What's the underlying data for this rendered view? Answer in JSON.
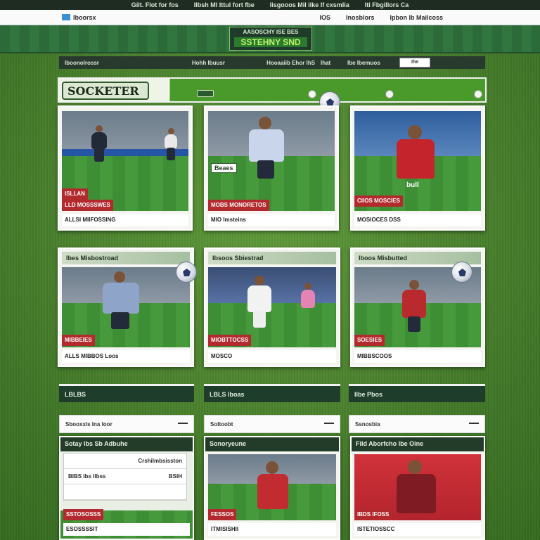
{
  "top_strip": [
    "Gilt. Flot for fos",
    "Ilbsh Ml Ittul fort fbe",
    "Iisgooos Mil ilke If cxsmlia",
    "Iti Fbgillors Ca"
  ],
  "nav": {
    "brand_label": "Iboorsx",
    "right_items": [
      "IOS",
      "Inosblors",
      "Ipbon Ib Mailcoss"
    ]
  },
  "hero": {
    "line1": "AASOSCHY ISE BES",
    "line2": "SSTEHNY SND"
  },
  "toolbar": {
    "item1": "Iboonolrossr",
    "item2": "Hohh Ibuusr",
    "item3": "Hooaaiib Ehor IhS",
    "item4": "Ihat",
    "item5": "Ibe Ibemuos",
    "search_placeholder": "Ihe"
  },
  "main": {
    "brand": "SOCKETER"
  },
  "row1": [
    {
      "caption_red": "LLD MOSSSWES",
      "caption_bottom": "ALLSI MIIFOSSING",
      "extra": "ISLLAN"
    },
    {
      "name_tag": "Beaes",
      "caption_red": "MOBS MONORETOS",
      "caption_bottom": "MIO Imsteins"
    },
    {
      "jersey": "bull",
      "caption_red": "CIIOS MOSCIES",
      "caption_bottom": "MOSIOCES DSS"
    }
  ],
  "row2": [
    {
      "label": "Ibes Misbostroad",
      "caption_red": "MIBBEIES",
      "caption_bottom": "ALLS MIBBOS Loos"
    },
    {
      "label": "Ibsoos Sbiestrad",
      "caption_red": "MIOBTTOCSS",
      "caption_bottom": "MOSCO"
    },
    {
      "label": "Iboos Misbutted",
      "caption_red": "SOESIES",
      "caption_bottom": "MIBBSCOOS"
    }
  ],
  "sections": [
    {
      "title": "LBLBS",
      "row": "Sbooxxls Ina Ioor"
    },
    {
      "title": "LBLS lboas",
      "row": "Soltoobt"
    },
    {
      "title": "Ilbe Pbos",
      "row": "Ssnosbia"
    }
  ],
  "bottom": [
    {
      "subhead": "Sotay Ibs Sb Adbuhe",
      "rows": [
        {
          "k": "",
          "v": "Crshilmbsisston"
        },
        {
          "k": "BIBS Ibs Ilbss",
          "v": "BSIH"
        },
        {
          "k": "",
          "v": ""
        }
      ],
      "caption_red": "SSTOSOSSS",
      "caption_bottom": "ESOSSSSIT"
    },
    {
      "subhead": "Sonoryeune",
      "caption_red": "FESSOS",
      "caption_bottom": "ITMISISHII"
    },
    {
      "subhead": "Fild Aborfcho Ibe Oine",
      "caption_red": "IBDS IFOSS",
      "caption_bottom": "ISTETIOSSCC"
    }
  ],
  "colors": {
    "grass": "#4f8a33",
    "dark_green": "#1f3d2b",
    "accent_red": "#b32a2e",
    "nav_blue": "#3a8fd6"
  }
}
